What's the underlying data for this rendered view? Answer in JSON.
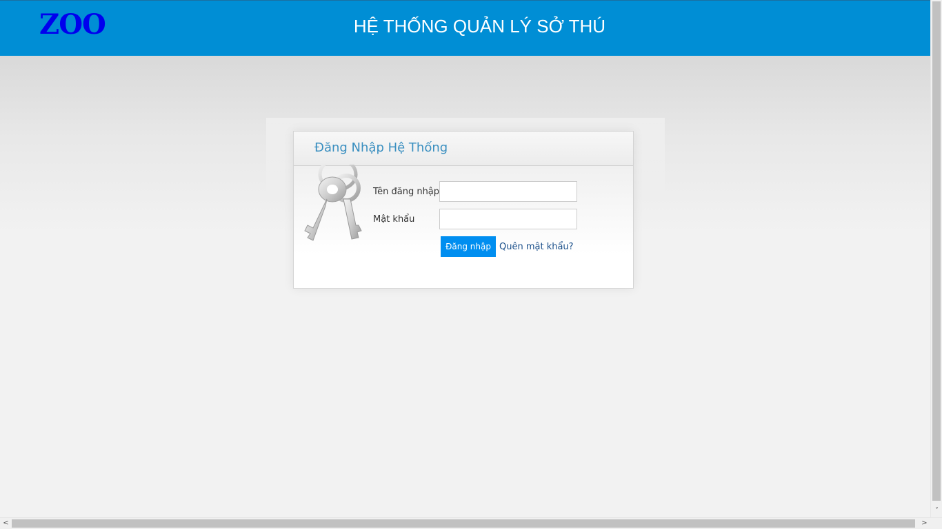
{
  "header": {
    "logo_text": "ZOO",
    "title": "HỆ THỐNG QUẢN LÝ SỞ THÚ",
    "background_color": "#008ed5",
    "logo_color": "#0000ee"
  },
  "login": {
    "title": "Đăng Nhập Hệ Thống",
    "username_label": "Tên đăng nhập",
    "username_value": "",
    "password_label": "Mật khẩu",
    "password_value": "",
    "submit_label": "Đăng nhập",
    "forgot_link": "Quên mật khẩu?",
    "icon": "keys-icon",
    "accent_color": "#008ef0"
  },
  "scrollbars": {
    "vertical_arrow_down": "˅",
    "left_arrow": "<",
    "right_arrow": ">"
  }
}
